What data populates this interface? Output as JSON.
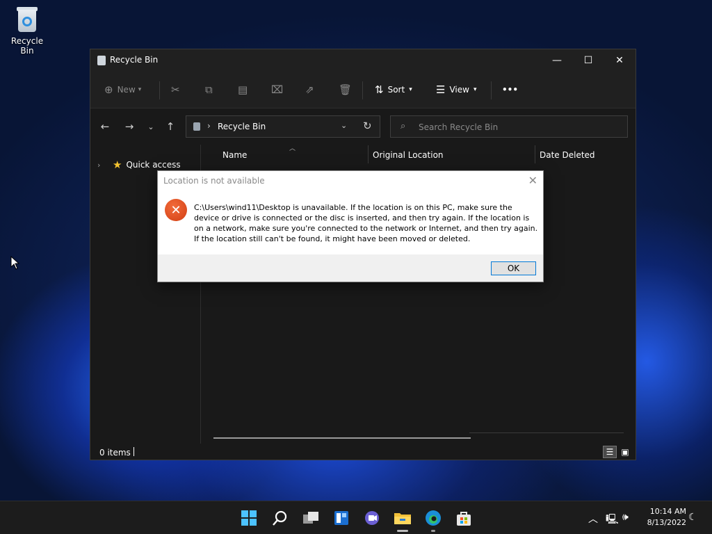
{
  "desktop": {
    "recycle_bin_label": "Recycle Bin"
  },
  "window": {
    "title": "Recycle Bin",
    "controls": {
      "minimize": "—",
      "maximize": "☐",
      "close": "✕"
    }
  },
  "toolbar": {
    "new_label": "New",
    "sort_label": "Sort",
    "view_label": "View",
    "more_label": "•••"
  },
  "nav": {
    "address_text": "Recycle Bin",
    "search_placeholder": "Search Recycle Bin"
  },
  "sidebar": {
    "quick_access": "Quick access"
  },
  "columns": {
    "name": "Name",
    "original_location": "Original Location",
    "date_deleted": "Date Deleted"
  },
  "status": {
    "item_count": "0 items"
  },
  "dialog": {
    "title": "Location is not available",
    "message": "C:\\Users\\wind11\\Desktop is unavailable. If the location is on this PC, make sure the device or drive is connected or the disc is inserted, and then try again. If the location is on a network, make sure you're connected to the network or Internet, and then try again. If the location still can't be found, it might have been moved or deleted.",
    "ok_label": "OK"
  },
  "taskbar": {
    "time": "10:14 AM",
    "date": "8/13/2022"
  },
  "colors": {
    "accent": "#0078d7",
    "error": "#d23f14",
    "explorer_bg": "#191919"
  }
}
